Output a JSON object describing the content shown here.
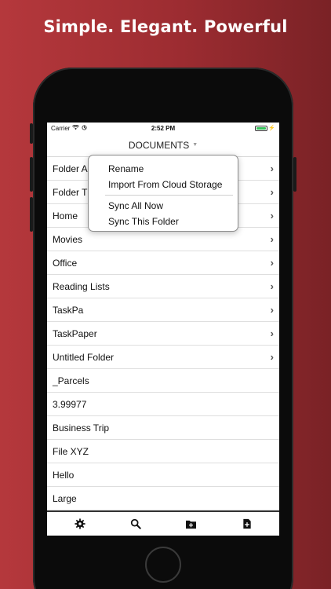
{
  "headline": "Simple. Elegant. Powerful",
  "status_bar": {
    "carrier": "Carrier",
    "time": "2:52 PM"
  },
  "nav": {
    "title": "DOCUMENTS"
  },
  "folders": [
    "Folder A",
    "Folder T",
    "Home",
    "Movies",
    "Office",
    "Reading Lists",
    "TaskPa",
    "TaskPaper",
    "Untitled Folder"
  ],
  "files": [
    "_Parcels",
    "3.99977",
    "Business Trip",
    "File XYZ",
    "Hello",
    "Large"
  ],
  "context_menu": {
    "rename": "Rename",
    "import": "Import From Cloud Storage",
    "sync_all": "Sync All Now",
    "sync_folder": "Sync This Folder"
  },
  "toolbar": {
    "settings_icon": "gear-icon",
    "search_icon": "search-icon",
    "new_folder_icon": "new-folder-icon",
    "new_file_icon": "new-file-icon"
  },
  "colors": {
    "background": "#a83136",
    "battery": "#35c25a"
  }
}
